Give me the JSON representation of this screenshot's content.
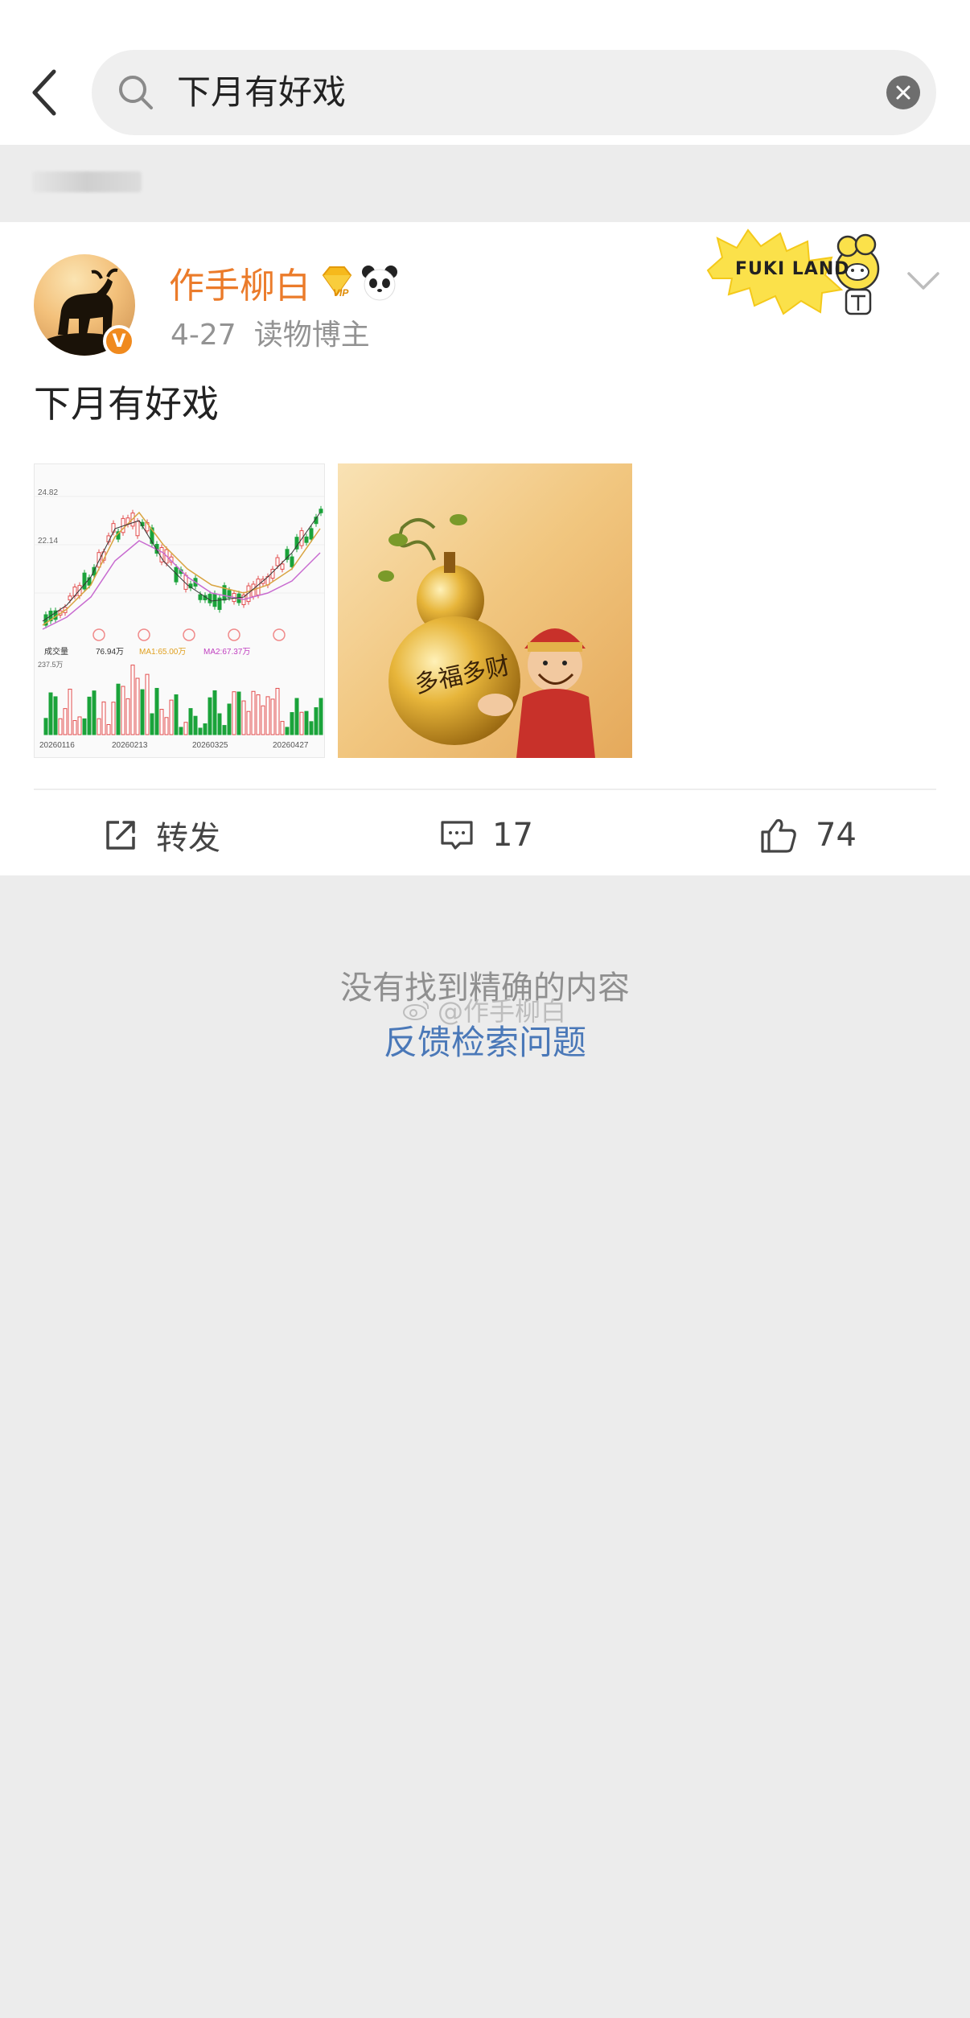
{
  "search": {
    "query": "下月有好戏"
  },
  "post": {
    "username": "作手柳白",
    "date": "4-27",
    "source": "读物博主",
    "badge_text": "FUKI LAND",
    "text": "下月有好戏",
    "image2_caption": "多福多财",
    "chart_image": {
      "label_high": "24.82",
      "label_mid": "22.14",
      "volume_label": "成交量",
      "volume_value": "76.94万",
      "ma1": "MA1:65.00万",
      "ma2": "MA2:67.37万",
      "vol_axis": "237.5万",
      "dates": [
        "20260116",
        "20260213",
        "20260325",
        "20260427"
      ]
    },
    "actions": {
      "repost_label": "转发",
      "comment_count": "17",
      "like_count": "74"
    }
  },
  "empty_notice": {
    "message": "没有找到精确的内容",
    "feedback_link": "反馈检索问题",
    "watermark": "@作手柳白"
  },
  "colors": {
    "username": "#eb7b2a",
    "link": "#4a78b8",
    "background": "#ececec"
  }
}
